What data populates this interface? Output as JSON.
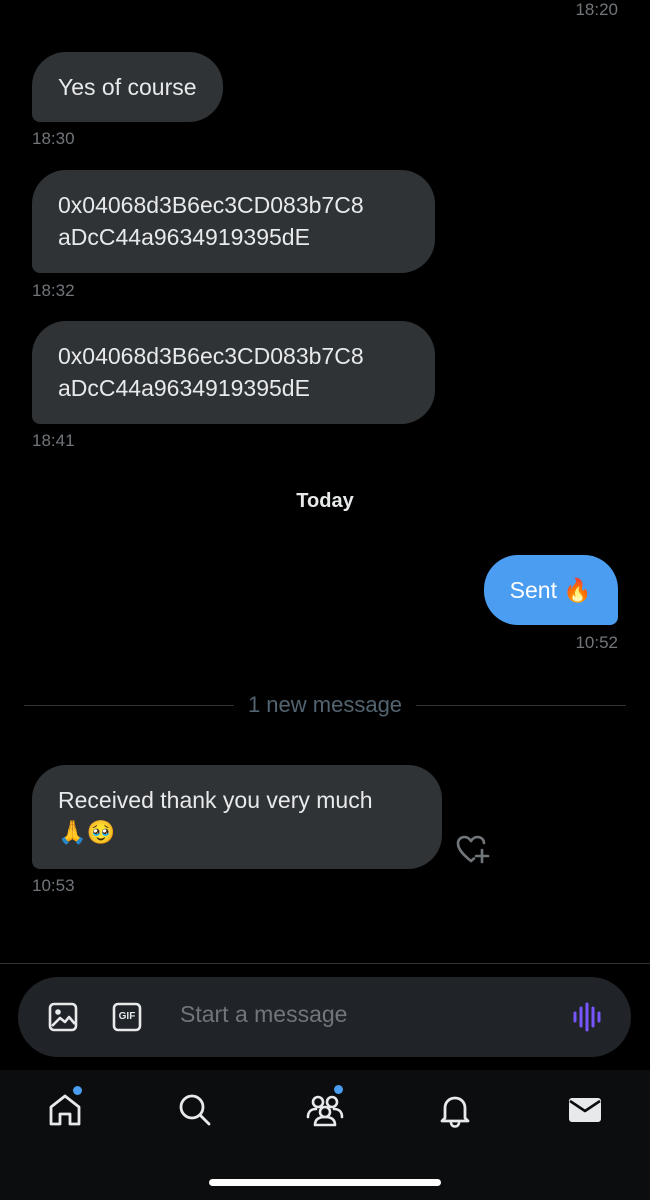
{
  "messages": [
    {
      "time_top": "18:20"
    },
    {
      "text": "Yes of course",
      "time": "18:30"
    },
    {
      "line1": "0x04068d3B6ec3CD083b7C8",
      "line2": "aDcC44a9634919395dE",
      "time": "18:32"
    },
    {
      "line1": "0x04068d3B6ec3CD083b7C8",
      "line2": "aDcC44a9634919395dE",
      "time": "18:41"
    }
  ],
  "day_separator": "Today",
  "sent": {
    "text": "Sent",
    "emoji": "🔥",
    "time": "10:52"
  },
  "new_message_divider": "1 new message",
  "received": {
    "line1": "Received thank you very much",
    "line2": "🙏🥹",
    "time": "10:53"
  },
  "composer": {
    "placeholder": "Start a message",
    "gif_label": "GIF"
  },
  "colors": {
    "accent": "#4a9df0",
    "bubble_in": "#2f3336",
    "voice": "#7856ff"
  },
  "nav": [
    "home-icon",
    "search-icon",
    "communities-icon",
    "notifications-icon",
    "messages-icon"
  ]
}
